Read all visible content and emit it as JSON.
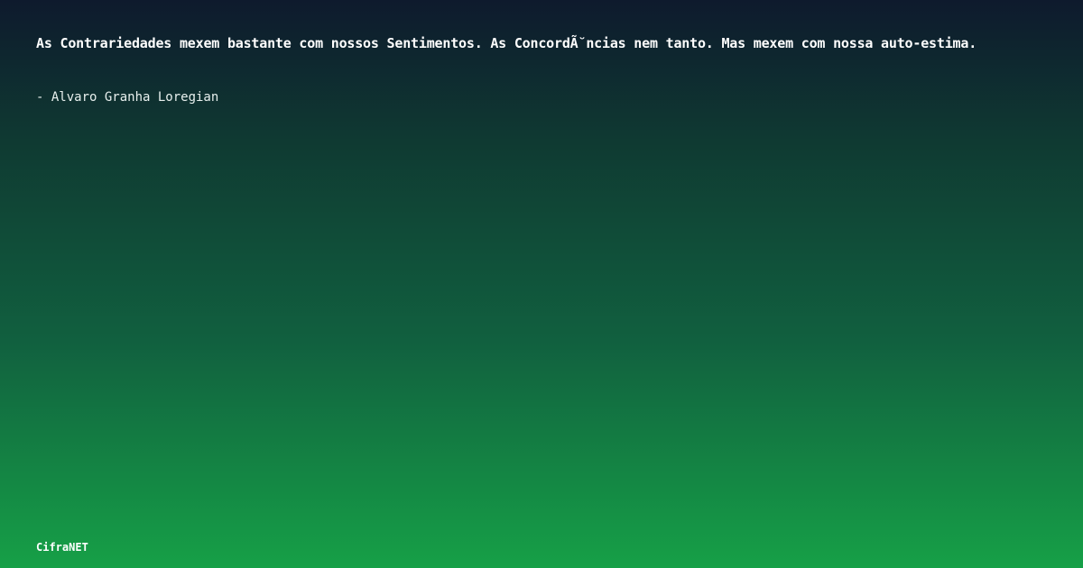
{
  "quote": {
    "text": "As Contrariedades mexem bastante com nossos Sentimentos. As ConcordÃ˘ncias nem tanto. Mas mexem com nossa auto-estima.",
    "author": "- Alvaro Granha Loregian"
  },
  "footer": {
    "brand": "CifraNET"
  },
  "colors": {
    "gradient_top": "#0e1a2d",
    "gradient_bottom": "#16a047",
    "text": "#ffffff"
  }
}
